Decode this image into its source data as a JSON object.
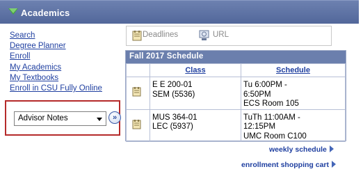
{
  "header": {
    "title": "Academics"
  },
  "links": [
    "Search",
    "Degree Planner",
    "Enroll",
    "My Academics",
    "My Textbooks",
    "Enroll in CSU Fully Online"
  ],
  "advisor_select": {
    "selected": "Advisor Notes",
    "go_label": "»"
  },
  "toolbar": {
    "deadlines_label": "Deadlines",
    "url_label": "URL"
  },
  "schedule": {
    "title": "Fall 2017 Schedule",
    "headers": {
      "class": "Class",
      "schedule": "Schedule"
    },
    "rows": [
      {
        "class_line1": "E E 200-01",
        "class_line2": "SEM (5536)",
        "schedule_line1": "Tu 6:00PM -",
        "schedule_line2": "6:50PM",
        "schedule_line3": "ECS  Room 105"
      },
      {
        "class_line1": "MUS 364-01",
        "class_line2": "LEC (5937)",
        "schedule_line1": "TuTh 11:00AM -",
        "schedule_line2": "12:15PM",
        "schedule_line3": "UMC  Room C100"
      }
    ]
  },
  "footer_links": {
    "weekly": "weekly schedule",
    "cart": "enrollment shopping cart"
  },
  "colors": {
    "header_bg": "#52679a",
    "link": "#1f3fa0",
    "highlight_border": "#b52a2a",
    "expand_arrow": "#44a33c"
  }
}
